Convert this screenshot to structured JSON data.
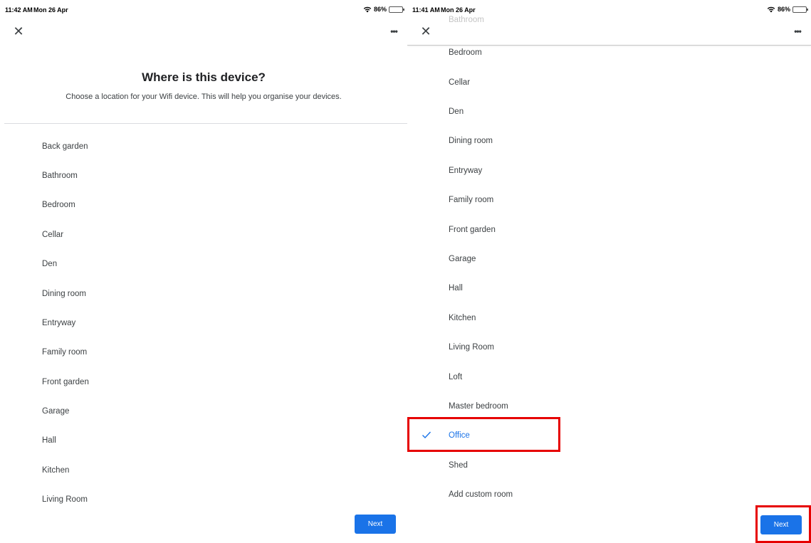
{
  "left_screen": {
    "status": {
      "time": "11:42 AM",
      "date": "Mon 26 Apr",
      "battery": "86%"
    },
    "title": "Where is this device?",
    "subtitle": "Choose a location for your Wifi device. This will help you organise your devices.",
    "rooms": [
      "Back garden",
      "Bathroom",
      "Bedroom",
      "Cellar",
      "Den",
      "Dining room",
      "Entryway",
      "Family room",
      "Front garden",
      "Garage",
      "Hall",
      "Kitchen",
      "Living Room"
    ],
    "next_label": "Next"
  },
  "right_screen": {
    "status": {
      "time": "11:41 AM",
      "date": "Mon 26 Apr",
      "battery": "86%"
    },
    "peek_label": "Bathroom",
    "rooms": [
      "Bedroom",
      "Cellar",
      "Den",
      "Dining room",
      "Entryway",
      "Family room",
      "Front garden",
      "Garage",
      "Hall",
      "Kitchen",
      "Living Room",
      "Loft",
      "Master bedroom",
      "Office",
      "Shed",
      "Add custom room"
    ],
    "selected_room": "Office",
    "next_label": "Next"
  },
  "icons": {
    "close": "close-icon",
    "more": "more-options-icon",
    "check": "check-icon",
    "wifi": "wifi-icon",
    "battery": "battery-icon"
  },
  "colors": {
    "accent": "#1a73e8",
    "highlight": "#e60000",
    "text": "#3c4043",
    "divider": "#dadce0"
  }
}
